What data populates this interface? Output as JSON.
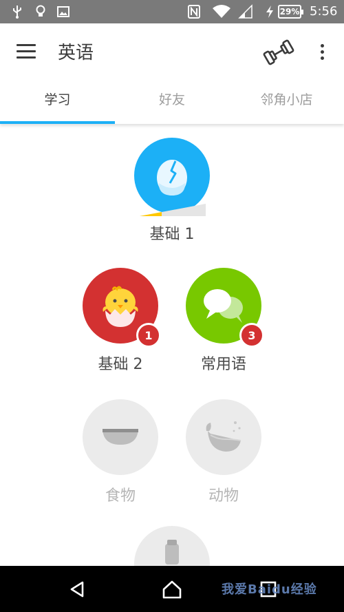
{
  "status_bar": {
    "battery": "29%",
    "time": "5:56",
    "icons": [
      "usb-icon",
      "lightbulb-icon",
      "image-icon",
      "nfc-icon",
      "wifi-icon",
      "signal-icon",
      "charging-icon"
    ]
  },
  "app_bar": {
    "title": "英语",
    "icons": [
      "menu-icon",
      "dumbbell-icon",
      "more-vert-icon"
    ]
  },
  "tabs": [
    {
      "label": "学习",
      "active": true
    },
    {
      "label": "好友",
      "active": false
    },
    {
      "label": "邻角小店",
      "active": false
    }
  ],
  "skills": [
    {
      "label": "基础 1",
      "state": "active",
      "color": "#1cb0f6",
      "icon": "cracked-egg-icon",
      "progress": 0.15
    },
    {
      "label": "基础 2",
      "state": "available",
      "color": "#d33131",
      "icon": "chick-icon",
      "badge": "1"
    },
    {
      "label": "常用语",
      "state": "available",
      "color": "#78c800",
      "icon": "speech-bubbles-icon",
      "badge": "3"
    },
    {
      "label": "食物",
      "state": "locked",
      "color": "#ebebeb",
      "icon": "bowl-icon"
    },
    {
      "label": "动物",
      "state": "locked",
      "color": "#ebebeb",
      "icon": "whale-icon"
    }
  ],
  "colors": {
    "accent": "#1cb0f6",
    "status_bar": "#7a7a7a",
    "badge": "#d33131",
    "locked": "#ebebeb"
  },
  "nav_bar": {
    "icons": [
      "back-icon",
      "home-icon",
      "recents-icon"
    ],
    "watermark": "我爱Baidu经验"
  }
}
